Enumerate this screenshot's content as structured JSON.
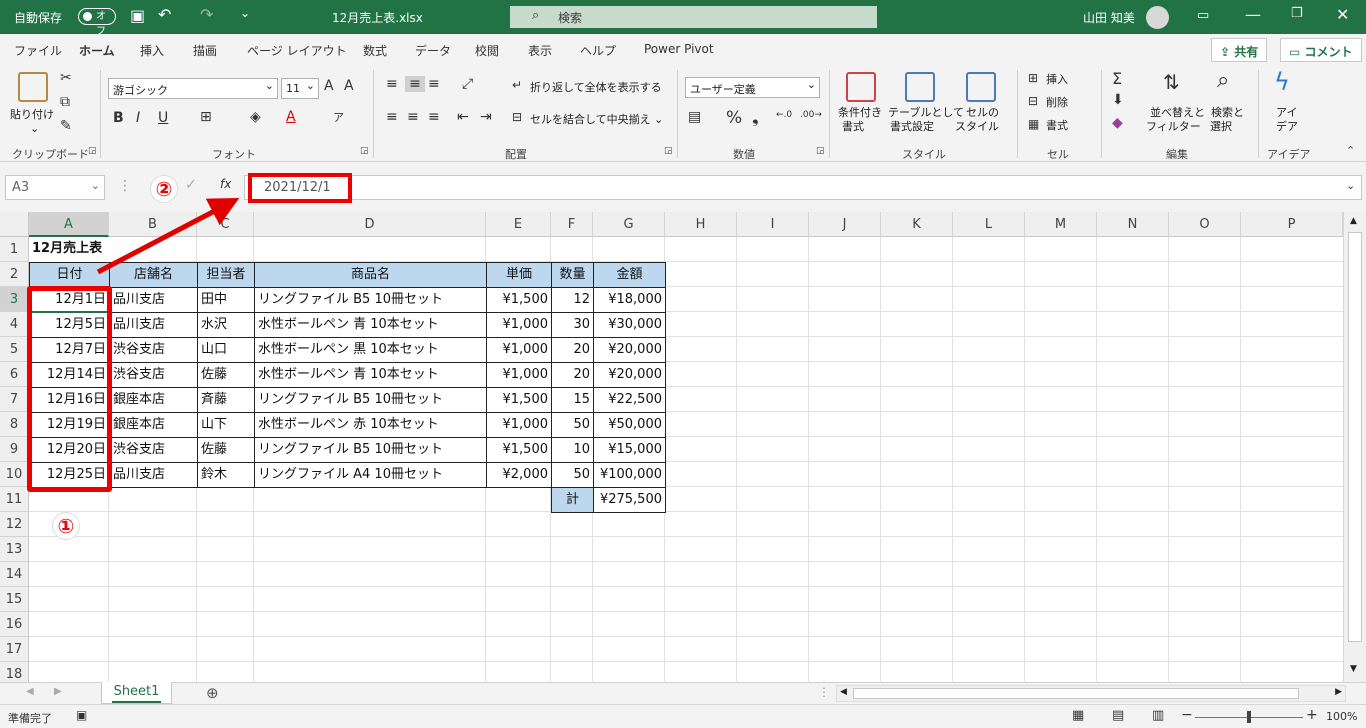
{
  "titlebar": {
    "autosave_label": "自動保存",
    "autosave_state": "オフ",
    "filename": "12月売上表.xlsx",
    "search_placeholder": "検索",
    "user_name": "山田 知美"
  },
  "tabs": [
    "ファイル",
    "ホーム",
    "挿入",
    "描画",
    "ページ レイアウト",
    "数式",
    "データ",
    "校閲",
    "表示",
    "ヘルプ",
    "Power Pivot"
  ],
  "share_label": "共有",
  "comment_label": "コメント",
  "ribbon": {
    "clipboard": {
      "paste": "貼り付け",
      "label": "クリップボード"
    },
    "font": {
      "name": "游ゴシック",
      "size": "11",
      "label": "フォント",
      "color_accent": "#e00000"
    },
    "alignment": {
      "wrap": "折り返して全体を表示する",
      "merge": "セルを結合して中央揃え",
      "label": "配置"
    },
    "number": {
      "format": "ユーザー定義",
      "label": "数値"
    },
    "styles": {
      "cond1": "条件付き",
      "cond2": "書式",
      "table1": "テーブルとして",
      "table2": "書式設定",
      "cell1": "セルの",
      "cell2": "スタイル",
      "label": "スタイル"
    },
    "cells": {
      "insert": "挿入",
      "delete": "削除",
      "format": "書式",
      "label": "セル"
    },
    "editing": {
      "sort1": "並べ替えと",
      "sort2": "フィルター",
      "find1": "検索と",
      "find2": "選択",
      "label": "編集"
    },
    "ideas": {
      "b1": "アイ",
      "b2": "デア",
      "label": "アイデア"
    }
  },
  "formula_bar": {
    "namebox": "A3",
    "fx": "fx",
    "value": "2021/12/1"
  },
  "columns": [
    "A",
    "B",
    "C",
    "D",
    "E",
    "F",
    "G",
    "H",
    "I",
    "J",
    "K",
    "L",
    "M",
    "N",
    "O",
    "P"
  ],
  "rows": [
    "1",
    "2",
    "3",
    "4",
    "5",
    "6",
    "7",
    "8",
    "9",
    "10",
    "11",
    "12",
    "13",
    "14",
    "15",
    "16",
    "17",
    "18"
  ],
  "sheet": {
    "title": "12月売上表",
    "headers": [
      "日付",
      "店舗名",
      "担当者",
      "商品名",
      "単価",
      "数量",
      "金額"
    ],
    "data": [
      [
        "12月1日",
        "品川支店",
        "田中",
        "リングファイル B5 10冊セット",
        "¥1,500",
        "12",
        "¥18,000"
      ],
      [
        "12月5日",
        "品川支店",
        "水沢",
        "水性ボールペン 青 10本セット",
        "¥1,000",
        "30",
        "¥30,000"
      ],
      [
        "12月7日",
        "渋谷支店",
        "山口",
        "水性ボールペン 黒 10本セット",
        "¥1,000",
        "20",
        "¥20,000"
      ],
      [
        "12月14日",
        "渋谷支店",
        "佐藤",
        "水性ボールペン 青 10本セット",
        "¥1,000",
        "20",
        "¥20,000"
      ],
      [
        "12月16日",
        "銀座本店",
        "斉藤",
        "リングファイル B5 10冊セット",
        "¥1,500",
        "15",
        "¥22,500"
      ],
      [
        "12月19日",
        "銀座本店",
        "山下",
        "水性ボールペン 赤 10本セット",
        "¥1,000",
        "50",
        "¥50,000"
      ],
      [
        "12月20日",
        "渋谷支店",
        "佐藤",
        "リングファイル B5 10冊セット",
        "¥1,500",
        "10",
        "¥15,000"
      ],
      [
        "12月25日",
        "品川支店",
        "鈴木",
        "リングファイル A4 10冊セット",
        "¥2,000",
        "50",
        "¥100,000"
      ]
    ],
    "total_label": "計",
    "total_value": "¥275,500"
  },
  "annotations": {
    "marker1": "①",
    "marker2": "②",
    "color": "#e00000"
  },
  "sheet_tab": "Sheet1",
  "status": {
    "ready": "準備完了",
    "zoom": "100%"
  },
  "colors": {
    "brand": "#217346",
    "header_fill": "#bdd7ee"
  }
}
